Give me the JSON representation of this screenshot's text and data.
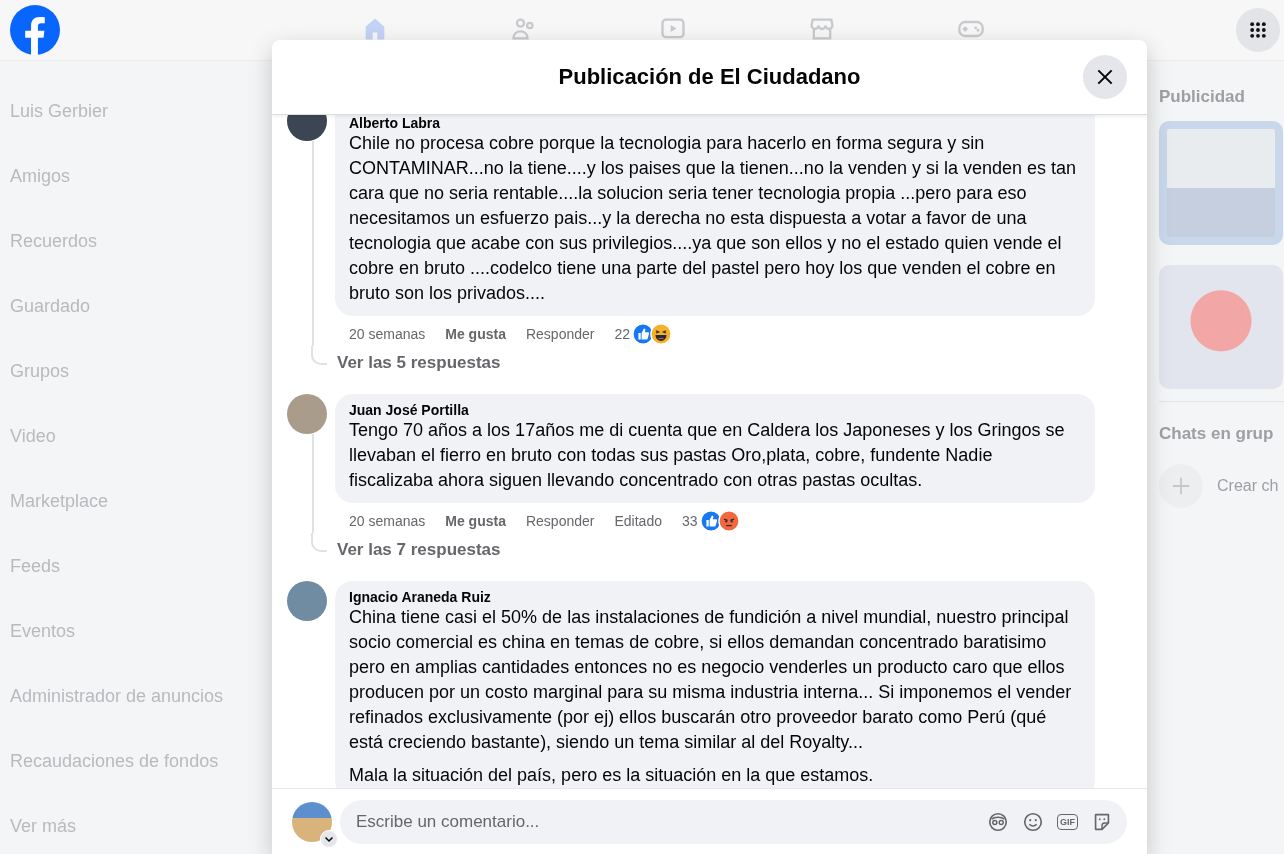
{
  "nav": {
    "tabs": [
      {
        "kind": "home",
        "selected": true
      },
      {
        "kind": "friends",
        "selected": false
      },
      {
        "kind": "video",
        "selected": false
      },
      {
        "kind": "store",
        "selected": false
      },
      {
        "kind": "games",
        "selected": false
      }
    ]
  },
  "sidebar": {
    "items": [
      "Luis Gerbier",
      "Amigos",
      "Recuerdos",
      "Guardado",
      "Grupos",
      "Video",
      "Marketplace",
      "Feeds",
      "Eventos",
      "Administrador de anuncios",
      "Recaudaciones de fondos",
      "Ver más"
    ]
  },
  "right_column": {
    "ads_title": "Publicidad",
    "ads": [
      {
        "kind": "photo"
      },
      {
        "kind": "photo"
      }
    ],
    "chats_title": "Chats en grup",
    "create_label": "Crear ch"
  },
  "dialog": {
    "title": "Publicación de El Ciudadano",
    "comments": [
      {
        "author": "Alberto Labra",
        "paragraphs": [
          "Chile no procesa cobre porque la tecnologia para hacerlo en forma segura y sin CONTAMINAR...no la tiene....y los paises que la tienen...no la venden y si la venden es tan cara que no seria rentable....la solucion seria tener tecnologia propia ...pero para eso necesitamos un esfuerzo pais...y la derecha no esta dispuesta a votar a favor de una tecnologia que acabe con sus privilegios....ya que son ellos y no el estado quien vende el cobre en bruto ....codelco tiene una parte del pastel pero hoy los que venden el cobre en bruto son los privados...."
        ],
        "time": "20 semanas",
        "like": "Me gusta",
        "reply": "Responder",
        "reaction_count": "22",
        "reactions": [
          {
            "kind": "like"
          },
          {
            "kind": "haha"
          }
        ],
        "replies_link": "Ver las 5 respuestas"
      },
      {
        "author": "Juan José Portilla",
        "paragraphs": [
          "Tengo 70 años a los 17años me di cuenta que en Caldera los Japoneses y los Gringos se llevaban el fierro en bruto con todas sus pastas Oro,plata, cobre, fundente Nadie fiscalizaba ahora siguen llevando concentrado con otras pastas ocultas."
        ],
        "time": "20 semanas",
        "like": "Me gusta",
        "reply": "Responder",
        "edited": "Editado",
        "reaction_count": "33",
        "reactions": [
          {
            "kind": "like"
          },
          {
            "kind": "angry"
          }
        ],
        "replies_link": "Ver las 7 respuestas"
      },
      {
        "author": "Ignacio Araneda Ruiz",
        "paragraphs": [
          "China tiene casi el 50% de las instalaciones de fundición a nivel mundial, nuestro principal socio comercial es china en temas de cobre, si ellos demandan concentrado baratisimo pero en amplias cantidades entonces no es negocio venderles un producto caro que ellos producen por un costo marginal para su misma industria interna... Si imponemos el vender refinados exclusivamente (por ej) ellos buscarán otro proveedor barato como Perú (qué está creciendo bastante), siendo un tema similar al del Royalty...",
          "Mala la situación del país, pero es la situación en la que estamos."
        ]
      }
    ],
    "composer": {
      "placeholder": "Escribe un comentario...",
      "tools": [
        {
          "kind": "avatar"
        },
        {
          "kind": "emoji"
        },
        {
          "kind": "gif",
          "label": "GIF"
        },
        {
          "kind": "sticker"
        }
      ]
    }
  }
}
